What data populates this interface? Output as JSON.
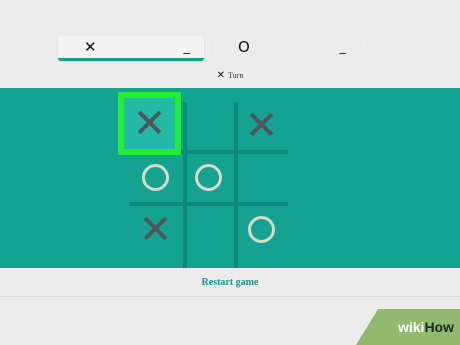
{
  "players": [
    {
      "mark": "✕",
      "score": "_"
    },
    {
      "mark": "O",
      "score": "_"
    }
  ],
  "turn": {
    "mark": "✕",
    "label": "Turn"
  },
  "board": {
    "cells": [
      {
        "row": 0,
        "col": 0,
        "value": "X",
        "highlighted": true
      },
      {
        "row": 0,
        "col": 1,
        "value": "",
        "highlighted": false
      },
      {
        "row": 0,
        "col": 2,
        "value": "X",
        "highlighted": false
      },
      {
        "row": 1,
        "col": 0,
        "value": "O",
        "highlighted": false
      },
      {
        "row": 1,
        "col": 1,
        "value": "O",
        "highlighted": false
      },
      {
        "row": 1,
        "col": 2,
        "value": "",
        "highlighted": false
      },
      {
        "row": 2,
        "col": 0,
        "value": "X",
        "highlighted": false
      },
      {
        "row": 2,
        "col": 1,
        "value": "",
        "highlighted": false
      },
      {
        "row": 2,
        "col": 2,
        "value": "O",
        "highlighted": false
      }
    ],
    "x_glyph": "✕"
  },
  "restart_label": "Restart game",
  "watermark": {
    "part1": "wiki",
    "part2": "How"
  },
  "colors": {
    "board_bg": "#14a291",
    "highlight": "#22ee33",
    "accent": "#11998a"
  }
}
